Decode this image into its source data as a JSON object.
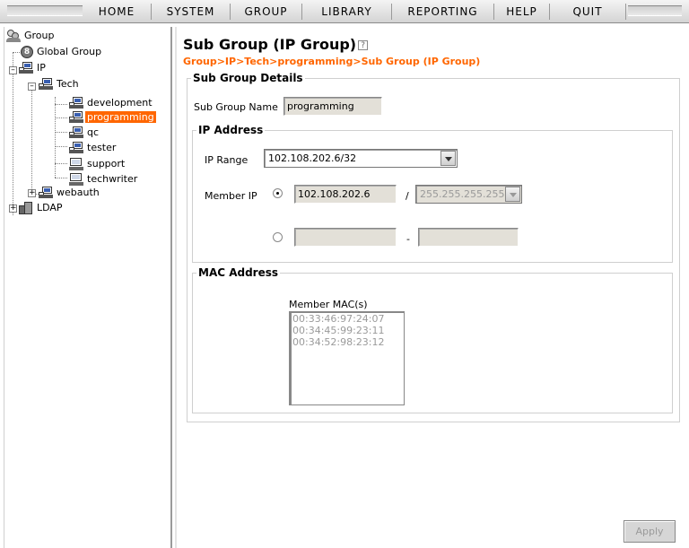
{
  "menu": {
    "items": [
      {
        "label": "HOME"
      },
      {
        "label": "SYSTEM"
      },
      {
        "label": "GROUP"
      },
      {
        "label": "LIBRARY"
      },
      {
        "label": "REPORTING"
      },
      {
        "label": "HELP"
      },
      {
        "label": "QUIT"
      }
    ]
  },
  "tree": {
    "group": "Group",
    "global_group": "Global Group",
    "ip": "IP",
    "tech": "Tech",
    "development": "development",
    "programming": "programming",
    "qc": "qc",
    "tester": "tester",
    "support": "support",
    "techwriter": "techwriter",
    "webauth": "webauth",
    "ldap": "LDAP"
  },
  "page": {
    "title": "Sub Group (IP Group)",
    "help_glyph": "?",
    "breadcrumb": "Group>IP>Tech>programming>Sub Group (IP Group)"
  },
  "details": {
    "legend": "Sub Group Details",
    "name_label": "Sub Group Name",
    "name_value": "programming"
  },
  "ip_address": {
    "legend": "IP Address",
    "range_label": "IP Range",
    "range_value": "102.108.202.6/32",
    "member_ip_label": "Member IP",
    "member_ip_value": "102.108.202.6",
    "slash": "/",
    "mask_value": "255.255.255.255",
    "dash": "-",
    "range_from": "",
    "range_to": ""
  },
  "mac": {
    "legend": "MAC Address",
    "list_label": "Member MAC(s)",
    "items": [
      "00:33:46:97:24:07",
      "00:34:45:99:23:11",
      "00:34:52:98:23:12"
    ]
  },
  "actions": {
    "apply": "Apply"
  }
}
